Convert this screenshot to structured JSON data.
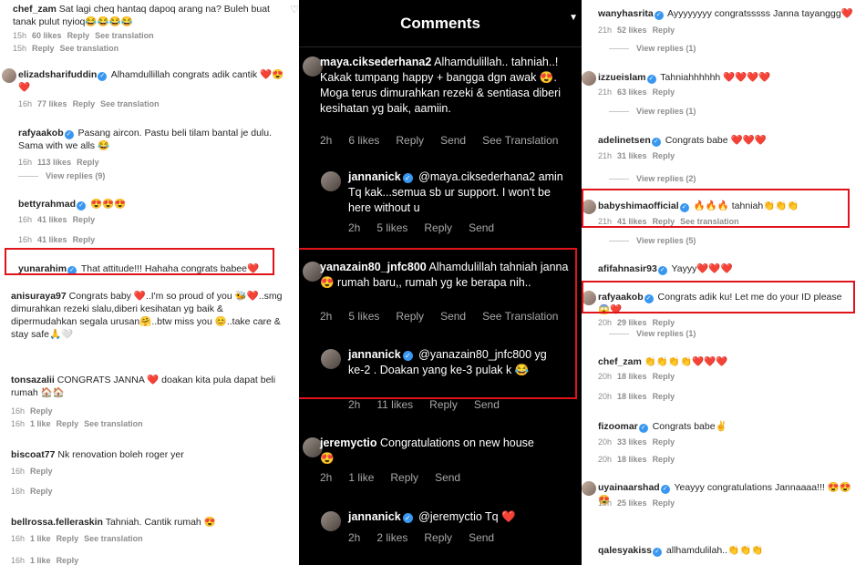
{
  "left": {
    "comments": [
      {
        "user": "chef_zam",
        "verified": false,
        "text": "Sat lagi cheq hantaq dapoq arang na? Buleh buat tanak pulut nyioq😂😂😂😂",
        "time": "15h",
        "likes": "60 likes",
        "reply": "Reply",
        "see": "See translation"
      },
      {
        "user": "elizadsharifuddin",
        "verified": true,
        "text": "Alhamdullillah congrats adik cantik ❤️😍❤️",
        "time": "16h",
        "likes": "77 likes",
        "reply": "Reply",
        "see": "See translation"
      },
      {
        "user": "rafyaakob",
        "verified": true,
        "text": "Pasang aircon. Pastu beli tilam bantal je dulu. Sama with we alls 😂",
        "time": "16h",
        "likes": "113 likes",
        "reply": "Reply",
        "view_replies": "View replies (9)"
      },
      {
        "user": "bettyrahmad",
        "verified": true,
        "text": "😍😍😍",
        "time": "16h",
        "likes": "41 likes",
        "reply": "Reply"
      },
      {
        "user": "yunarahim",
        "verified": true,
        "text": "That attitude!!! Hahaha congrats babee❤️",
        "time": "16h",
        "likes": "41 likes",
        "reply": "Reply"
      },
      {
        "user": "anisuraya97",
        "verified": false,
        "text": "Congrats baby ❤️..I'm so proud of you 🐝❤️..smg dimurahkan rezeki slalu,diberi kesihatan yg baik & dipermudahkan segala urusan🤗..btw miss you 😊..take care & stay safe🙏🤍",
        "time": "16h",
        "likes": "5 likes",
        "reply": "Reply",
        "see": "See translation"
      },
      {
        "user": "tonsazalii",
        "verified": false,
        "text": "CONGRATS JANNA ❤️ doakan kita pula dapat beli rumah 🏠🏠",
        "time": "16h",
        "likes": "1 like",
        "reply": "Reply",
        "see": "See translation"
      },
      {
        "user": "biscoat77",
        "verified": false,
        "text": "Nk renovation boleh roger yer",
        "time": "16h",
        "likes": "",
        "reply": "Reply"
      },
      {
        "user": "bellrossa.felleraskin",
        "verified": false,
        "text": "Tahniah. Cantik rumah 😍",
        "time": "16h",
        "likes": "1 like",
        "reply": "Reply",
        "see": "See translation"
      }
    ],
    "extra_time_1": "16h",
    "extra_reply_1": "Reply",
    "extra_time_2": "16h",
    "extra_reply_2": "Reply"
  },
  "middle": {
    "title": "Comments",
    "comments": [
      {
        "user": "maya.ciksederhana2",
        "verified": false,
        "text": "Alhamdulillah.. tahniah..! Kakak tumpang happy + bangga dgn awak 😍. Moga terus dimurahkan rezeki & sentiasa diberi kesihatan yg baik, aamiin.",
        "time": "2h",
        "likes": "6 likes",
        "reply": "Reply",
        "send": "Send",
        "see": "See Translation"
      },
      {
        "user": "jannanick",
        "verified": true,
        "text": "@maya.ciksederhana2 amin Tq kak...semua sb ur support. I won't be here without u",
        "time": "2h",
        "likes": "5 likes",
        "reply": "Reply",
        "send": "Send"
      },
      {
        "user": "yanazain80_jnfc800",
        "verified": false,
        "text": "Alhamdulillah tahniah janna 😍 rumah baru,, rumah yg ke berapa nih..",
        "time": "2h",
        "likes": "5 likes",
        "reply": "Reply",
        "send": "Send",
        "see": "See Translation"
      },
      {
        "user": "jannanick",
        "verified": true,
        "text": "@yanazain80_jnfc800 yg ke-2 . Doakan yang ke-3 pulak k 😂",
        "time": "2h",
        "likes": "11 likes",
        "reply": "Reply",
        "send": "Send"
      },
      {
        "user": "jeremyctio",
        "verified": false,
        "text": "Congratulations on new house 😍",
        "time": "2h",
        "likes": "1 like",
        "reply": "Reply",
        "send": "Send"
      },
      {
        "user": "jannanick",
        "verified": true,
        "text": "@jeremyctio Tq ❤️",
        "time": "2h",
        "likes": "2 likes",
        "reply": "Reply",
        "send": "Send"
      }
    ]
  },
  "right": {
    "comments": [
      {
        "user": "wanyhasrita",
        "verified": true,
        "text": "Ayyyyyyyy congratsssss Janna tayanggg❤️",
        "time": "21h",
        "likes": "52 likes",
        "reply": "Reply",
        "view_replies": "View replies (1)"
      },
      {
        "user": "izzueislam",
        "verified": true,
        "text": "Tahniahhhhhh ❤️❤️❤️❤️",
        "time": "21h",
        "likes": "63 likes",
        "reply": "Reply",
        "view_replies": "View replies (1)"
      },
      {
        "user": "adelinetsen",
        "verified": true,
        "text": "Congrats babe ❤️❤️❤️",
        "time": "21h",
        "likes": "31 likes",
        "reply": "Reply",
        "view_replies": "View replies (2)"
      },
      {
        "user": "babyshimaofficial",
        "verified": true,
        "text": "🔥🔥🔥 tahniah👏👏👏",
        "time": "21h",
        "likes": "41 likes",
        "reply": "Reply",
        "see": "See translation",
        "view_replies": "View replies (5)"
      },
      {
        "user": "afifahnasir93",
        "verified": true,
        "text": "Yayyy❤️❤️❤️",
        "time": "",
        "likes": "",
        "reply": ""
      },
      {
        "user": "rafyaakob",
        "verified": true,
        "text": "Congrats adik ku! Let me do your ID please 😱❤️",
        "time": "20h",
        "likes": "29 likes",
        "reply": "Reply",
        "view_replies": "View replies (1)"
      },
      {
        "user": "chef_zam",
        "verified": false,
        "text": "👏👏👏👏❤️❤️❤️",
        "time": "20h",
        "likes": "18 likes",
        "reply": "Reply"
      },
      {
        "user": "fizoomar",
        "verified": true,
        "text": "Congrats babe✌️",
        "time": "20h",
        "likes": "33 likes",
        "reply": "Reply"
      },
      {
        "user": "uyainaarshad",
        "verified": true,
        "text": "Yeayyy congratulations Jannaaaa!!! 😍😍😍",
        "time": "19h",
        "likes": "25 likes",
        "reply": "Reply"
      },
      {
        "user": "qalesyakiss",
        "verified": true,
        "text": "allhamdulilah..👏👏👏",
        "time": "",
        "likes": "",
        "reply": ""
      }
    ],
    "extra_time": "20h",
    "extra_likes": "18 likes",
    "extra_reply": "Reply"
  },
  "colors": {
    "highlight": "#e0131a",
    "verified": "#3897f0",
    "dark_bg": "#000000"
  }
}
